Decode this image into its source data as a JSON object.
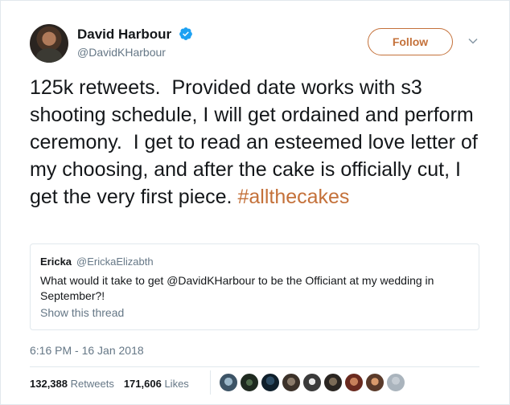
{
  "author": {
    "name": "David Harbour",
    "handle": "@DavidKHarbour",
    "verified": true
  },
  "follow_button": {
    "label": "Follow"
  },
  "tweet": {
    "text": "125k retweets.  Provided date works with s3 shooting schedule, I will get ordained and perform ceremony.  I get to read an esteemed love letter of my choosing, and after the cake is officially cut, I get the very first piece. ",
    "hashtag": "#allthecakes"
  },
  "quoted_tweet": {
    "name": "Ericka",
    "handle": "@ErickaElizabth",
    "text": "What would it take to get @DavidKHarbour to be the Officiant at my wedding in September?!",
    "show_thread": "Show this thread"
  },
  "timestamp": "6:16 PM - 16 Jan 2018",
  "stats": {
    "retweets_count": "132,388",
    "retweets_label": "Retweets",
    "likes_count": "171,606",
    "likes_label": "Likes"
  },
  "liker_avatars": [
    "avatar-1",
    "avatar-2",
    "avatar-3",
    "avatar-4",
    "avatar-5",
    "avatar-6",
    "avatar-7",
    "avatar-8",
    "avatar-9"
  ],
  "colors": {
    "accent": "#c4713a",
    "verified": "#1da1f2",
    "secondary_text": "#657786",
    "border": "#e1e8ed"
  },
  "icons": {
    "verified": "verified-badge-icon",
    "caret": "chevron-down-icon"
  }
}
